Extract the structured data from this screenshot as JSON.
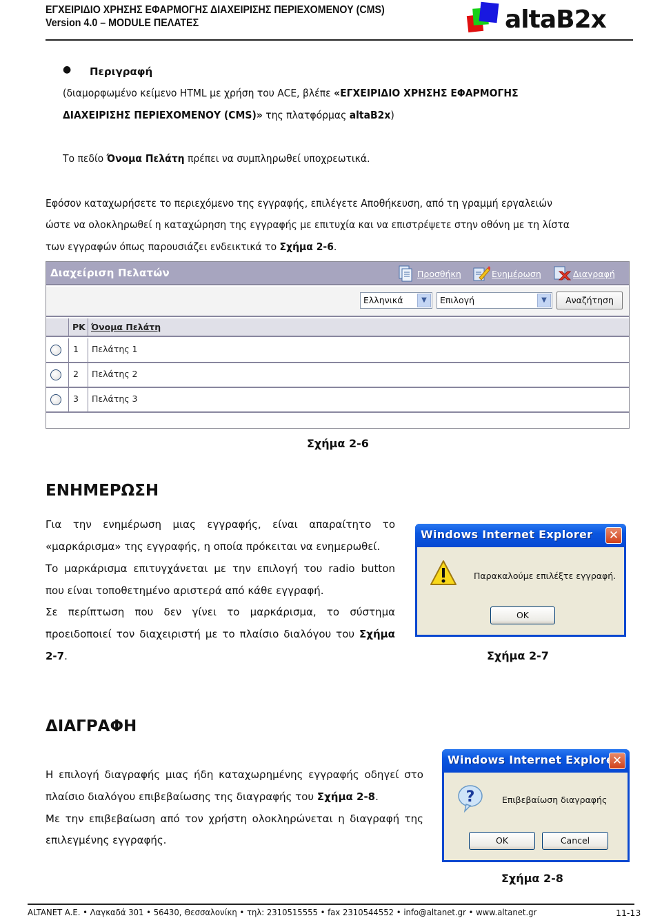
{
  "header": {
    "title_line1": "ΕΓΧΕΙΡΙΔΙΟ ΧΡΗΣΗΣ ΕΦΑΡΜΟΓΗΣ ΔΙΑΧΕΙΡΙΣΗΣ ΠΕΡΙΕΧΟΜΕΝΟΥ (CMS)",
    "title_line2": "Version 4.0 – MODULE ΠΕΛΑΤΕΣ",
    "logo_text": "altaB2x"
  },
  "intro": {
    "bullet_title": "Περιγραφή",
    "desc_line1_a": "(διαμορφωμένο κείμενο HTML με χρήση του ACE, βλέπε ",
    "desc_line1_b": "«ΕΓΧΕΙΡΙΔΙΟ ΧΡΗΣΗΣ ΕΦΑΡΜΟΓΗΣ",
    "desc_line2_a": "ΔΙΑΧΕΙΡΙΣΗΣ ΠΕΡΙΕΧΟΜΕΝΟΥ (CMS)»",
    "desc_line2_b": " της πλατφόρμας ",
    "desc_line2_c": "altaB2x",
    "desc_line2_d": ")",
    "required_a": "Το πεδίο ",
    "required_b": "Όνομα Πελάτη",
    "required_c": " πρέπει να συμπληρωθεί υποχρεωτικά.",
    "save_line1": "Εφόσον καταχωρήσετε το περιεχόμενο της εγγραφής, επιλέγετε Αποθήκευση, από τη γραμμή εργαλειών",
    "save_line2": "ώστε να ολοκληρωθεί η καταχώρηση της εγγραφής με επιτυχία και να επιστρέψετε στην οθόνη με τη λίστα",
    "save_line3_a": "των εγγραφών όπως παρουσιάζει ενδεικτικά το ",
    "save_line3_b": "Σχήμα 2-6",
    "save_line3_c": "."
  },
  "fig26": {
    "title": "Διαχείριση Πελατών",
    "toolbar": {
      "add": "Προσθήκη",
      "update": "Ενημέρωση",
      "delete": "Διαγραφή"
    },
    "language_select": "Ελληνικά",
    "field_select": "Επιλογή",
    "search_button": "Αναζήτηση",
    "columns": [
      "PK",
      "Όνομα Πελάτη"
    ],
    "rows": [
      {
        "pk": "1",
        "name": "Πελάτης 1"
      },
      {
        "pk": "2",
        "name": "Πελάτης 2"
      },
      {
        "pk": "3",
        "name": "Πελάτης 3"
      }
    ],
    "caption": "Σχήμα 2-6"
  },
  "update_section": {
    "title": "ΕΝΗΜΕΡΩΣΗ",
    "line1": "Για την ενημέρωση μιας εγγραφής, είναι απαραίτητο το",
    "line2": "«μαρκάρισμα» της εγγραφής, η οποία πρόκειται να ενημερωθεί.",
    "line3": "Το μαρκάρισμα επιτυγχάνεται με την επιλογή του radio button",
    "line4": "που είναι τοποθετημένο αριστερά από κάθε εγγραφή.",
    "line5": "Σε περίπτωση που δεν γίνει το μαρκάρισμα, το σύστημα",
    "line6_a": "προειδοποιεί τον διαχειριστή με το πλαίσιο διαλόγου του ",
    "line6_b": "Σχήμα",
    "line7_a": "2-7",
    "line7_b": ".",
    "dialog": {
      "title": "Windows Internet Explorer",
      "message": "Παρακαλούμε επιλέξτε εγγραφή.",
      "ok": "OK"
    },
    "caption": "Σχήμα 2-7"
  },
  "delete_section": {
    "title": "ΔΙΑΓΡΑΦΗ",
    "line1": "Η επιλογή διαγραφής μιας ήδη καταχωρημένης εγγραφής οδηγεί στο",
    "line2_a": "πλαίσιο διαλόγου επιβεβαίωσης της διαγραφής του ",
    "line2_b": "Σχήμα 2-8",
    "line2_c": ".",
    "line3": "Με την επιβεβαίωση από τον χρήστη ολοκληρώνεται η διαγραφή της",
    "line4": "επιλεγμένης εγγραφής.",
    "dialog": {
      "title": "Windows Internet Explorer",
      "message": "Επιβεβαίωση διαγραφής",
      "ok": "OK",
      "cancel": "Cancel"
    },
    "caption": "Σχήμα 2-8"
  },
  "footer": {
    "text": "ALTANET A.E. • Λαγκαδά 301 • 56430, Θεσσαλονίκη • τηλ: 2310515555 • fax 2310544552 • info@altanet.gr • www.altanet.gr",
    "page": "11-13"
  },
  "colors": {
    "panel_header": "#a7a5bf",
    "ie_titlebar": "#0a56e0",
    "dialog_bg": "#ece9d8"
  }
}
